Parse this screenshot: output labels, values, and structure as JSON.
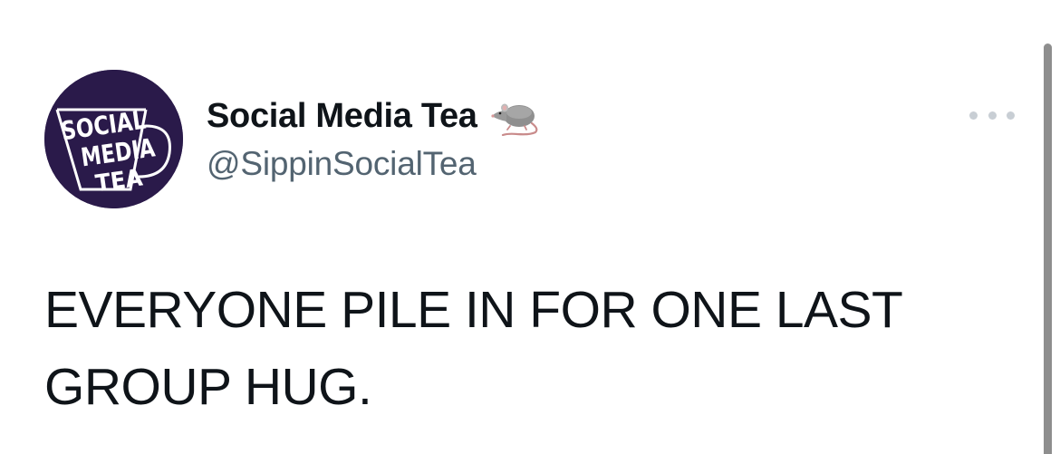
{
  "tweet": {
    "author": {
      "display_name": "Social Media Tea",
      "handle": "@SippinSocialTea",
      "name_emoji": "rat-icon",
      "avatar": {
        "logo_lines": [
          "SOCIAL",
          "MEDIA",
          "TEA"
        ],
        "background_color": "#2a1a4a",
        "text_color": "#ffffff"
      }
    },
    "text": "EVERYONE PILE IN FOR ONE LAST GROUP HUG.",
    "more_icon": "more-horizontal-icon"
  },
  "colors": {
    "name": "#0f1419",
    "handle": "#536471",
    "more_dots": "#c8ced4",
    "scrollbar": "#8e8e8e"
  }
}
